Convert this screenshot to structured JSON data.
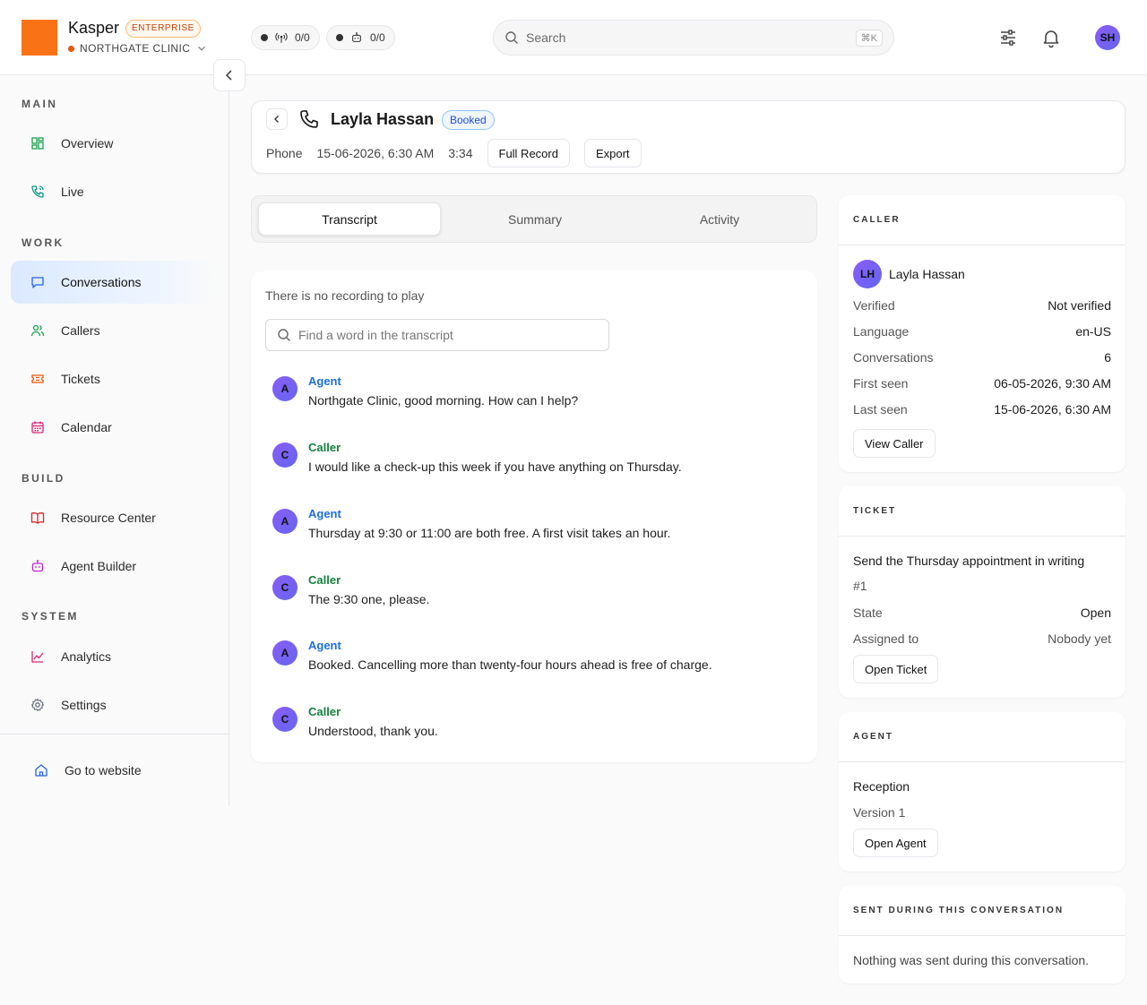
{
  "brand": {
    "name": "Kasper",
    "badge": "ENTERPRISE",
    "org": "NORTHGATE CLINIC"
  },
  "counters": [
    {
      "icon": "broadcast-icon",
      "value": "0/0"
    },
    {
      "icon": "robot-icon",
      "value": "0/0"
    }
  ],
  "search": {
    "placeholder": "Search",
    "shortcut": "⌘K"
  },
  "user": {
    "initials": "SH"
  },
  "sidebar": {
    "sections": [
      "MAIN",
      "WORK",
      "BUILD",
      "SYSTEM"
    ],
    "items": [
      {
        "label": "Overview",
        "icon": "grid-icon",
        "color": "#16a34a"
      },
      {
        "label": "Live",
        "icon": "phone-wave-icon",
        "color": "#0d9488"
      },
      {
        "label": "Conversations",
        "icon": "chat-icon",
        "color": "#2563eb",
        "active": true
      },
      {
        "label": "Callers",
        "icon": "users-icon",
        "color": "#16a34a"
      },
      {
        "label": "Tickets",
        "icon": "ticket-icon",
        "color": "#ea580c"
      },
      {
        "label": "Calendar",
        "icon": "calendar-icon",
        "color": "#db2777"
      },
      {
        "label": "Resource Center",
        "icon": "book-icon",
        "color": "#dc2626"
      },
      {
        "label": "Agent Builder",
        "icon": "robot-icon",
        "color": "#c026d3"
      },
      {
        "label": "Analytics",
        "icon": "chart-icon",
        "color": "#db2777"
      },
      {
        "label": "Settings",
        "icon": "gear-icon",
        "color": "#6b7280"
      }
    ],
    "footer_link": "Go to website"
  },
  "record": {
    "name": "Layla Hassan",
    "status": "Booked",
    "channel": "Phone",
    "datetime": "15-06-2026, 6:30 AM",
    "duration": "3:34",
    "full_record_label": "Full Record",
    "export_label": "Export"
  },
  "tabs": [
    {
      "label": "Transcript",
      "active": true
    },
    {
      "label": "Summary"
    },
    {
      "label": "Activity"
    }
  ],
  "transcript": {
    "no_recording": "There is no recording to play",
    "find_placeholder": "Find a word in the transcript",
    "messages": [
      {
        "role": "Agent",
        "initial": "A",
        "text": "Northgate Clinic, good morning. How can I help?"
      },
      {
        "role": "Caller",
        "initial": "C",
        "text": "I would like a check-up this week if you have anything on Thursday."
      },
      {
        "role": "Agent",
        "initial": "A",
        "text": "Thursday at 9:30 or 11:00 are both free. A first visit takes an hour."
      },
      {
        "role": "Caller",
        "initial": "C",
        "text": "The 9:30 one, please."
      },
      {
        "role": "Agent",
        "initial": "A",
        "text": "Booked. Cancelling more than twenty-four hours ahead is free of charge."
      },
      {
        "role": "Caller",
        "initial": "C",
        "text": "Understood, thank you."
      }
    ]
  },
  "caller_card": {
    "title": "CALLER",
    "initials": "LH",
    "name": "Layla Hassan",
    "fields": [
      {
        "label": "Verified",
        "value": "Not verified"
      },
      {
        "label": "Language",
        "value": "en-US"
      },
      {
        "label": "Conversations",
        "value": "6"
      },
      {
        "label": "First seen",
        "value": "06-05-2026, 9:30 AM"
      },
      {
        "label": "Last seen",
        "value": "15-06-2026, 6:30 AM"
      }
    ],
    "button": "View Caller"
  },
  "ticket_card": {
    "title": "TICKET",
    "subject": "Send the Thursday appointment in writing",
    "number": "#1",
    "fields": [
      {
        "label": "State",
        "value": "Open"
      },
      {
        "label": "Assigned to",
        "value": "Nobody yet"
      }
    ],
    "button": "Open Ticket"
  },
  "agent_card": {
    "title": "AGENT",
    "name": "Reception",
    "version": "Version 1",
    "button": "Open Agent"
  },
  "sent_card": {
    "title": "SENT DURING THIS CONVERSATION",
    "empty_text": "Nothing was sent during this conversation."
  }
}
